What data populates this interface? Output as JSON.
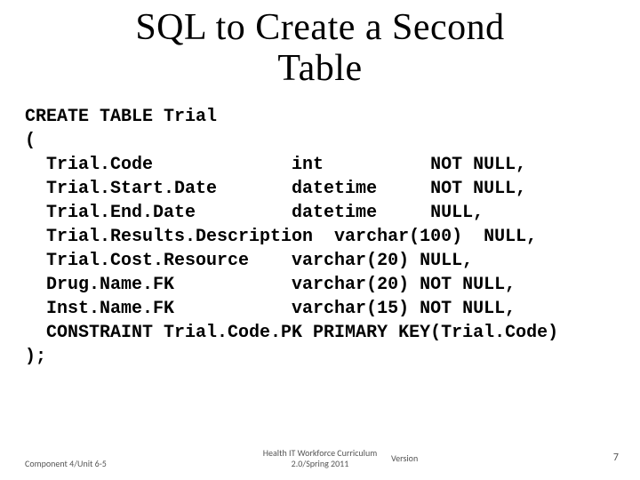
{
  "title_line1": "SQL to Create a Second",
  "title_line2": "Table",
  "code": {
    "l1": "CREATE TABLE Trial",
    "l2": "(",
    "l3": "  Trial.Code             int          NOT NULL,",
    "l4": "  Trial.Start.Date       datetime     NOT NULL,",
    "l5": "  Trial.End.Date         datetime     NULL,",
    "l6": "  Trial.Results.Description  varchar(100)  NULL,",
    "l7": "  Trial.Cost.Resource    varchar(20) NULL,",
    "l8": "  Drug.Name.FK           varchar(20) NOT NULL,",
    "l9": "  Inst.Name.FK           varchar(15) NOT NULL,",
    "l10": "  CONSTRAINT Trial.Code.PK PRIMARY KEY(Trial.Code)",
    "l11": ");"
  },
  "footer": {
    "left": "Component 4/Unit 6-5",
    "center_line1": "Health IT Workforce Curriculum",
    "center_line2": "2.0/Spring 2011",
    "version": "Version",
    "page": "7"
  }
}
